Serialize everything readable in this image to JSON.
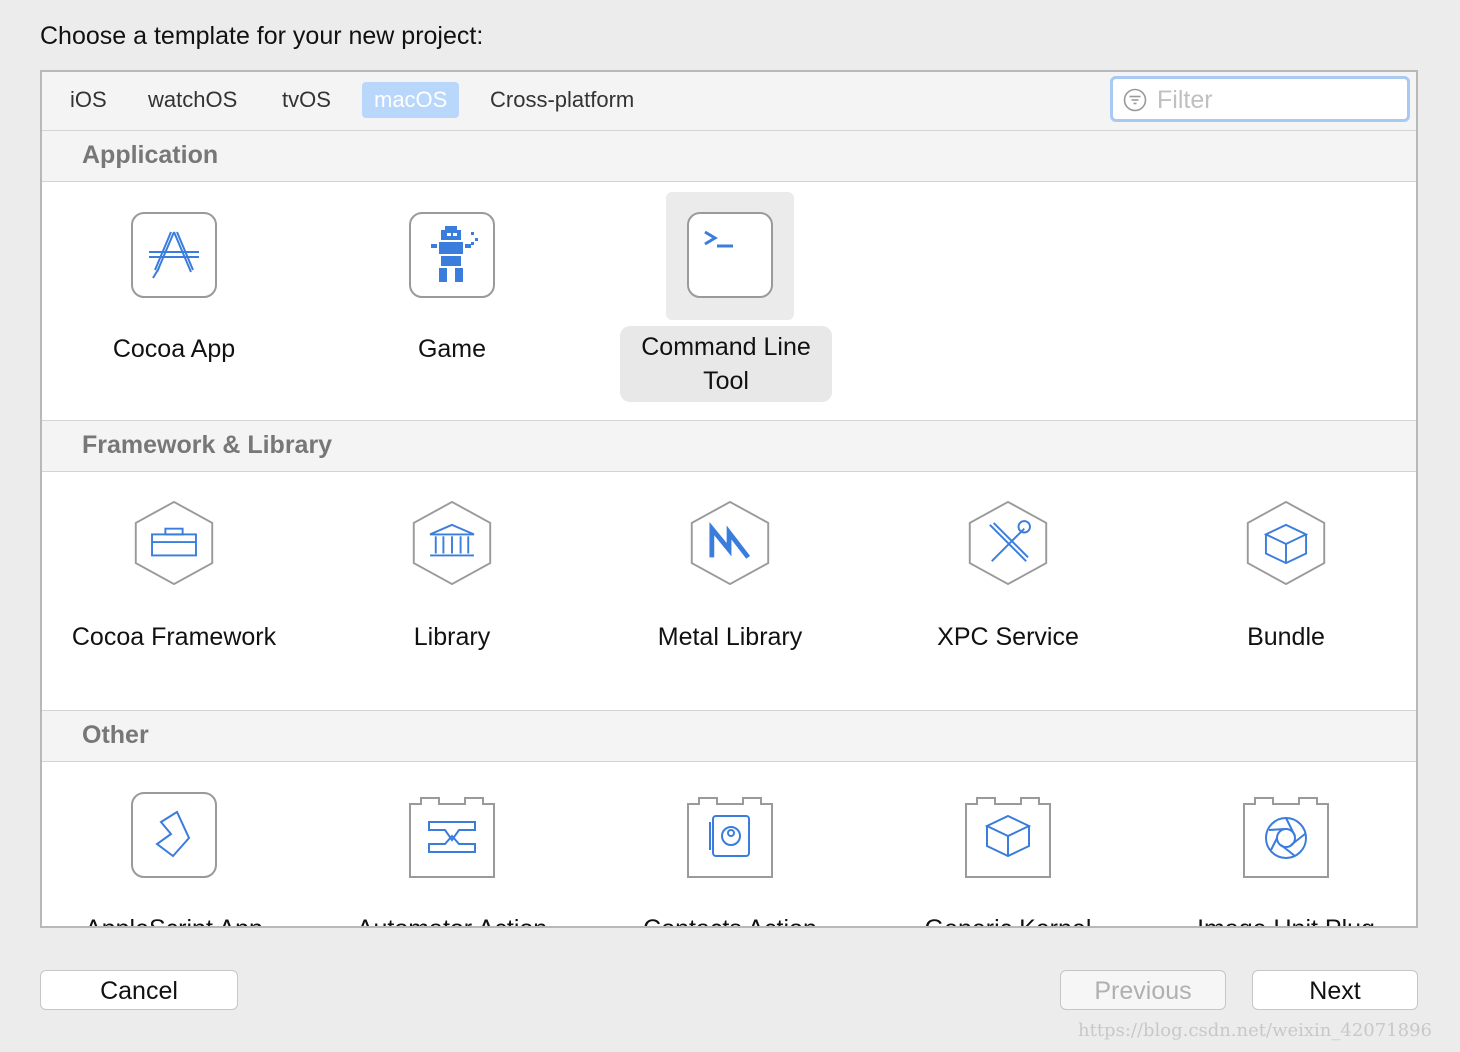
{
  "prompt": "Choose a template for your new project:",
  "tabs": [
    {
      "label": "iOS",
      "selected": false
    },
    {
      "label": "watchOS",
      "selected": false
    },
    {
      "label": "tvOS",
      "selected": false
    },
    {
      "label": "macOS",
      "selected": true
    },
    {
      "label": "Cross-platform",
      "selected": false
    }
  ],
  "filter": {
    "placeholder": "Filter"
  },
  "sections": {
    "application": {
      "title": "Application",
      "items": [
        {
          "label": "Cocoa App",
          "icon": "app-store-icon"
        },
        {
          "label": "Game",
          "icon": "game-icon"
        },
        {
          "label": "Command Line Tool",
          "icon": "terminal-icon",
          "selected": true
        }
      ]
    },
    "framework": {
      "title": "Framework & Library",
      "items": [
        {
          "label": "Cocoa Framework",
          "icon": "toolbox-icon"
        },
        {
          "label": "Library",
          "icon": "library-icon"
        },
        {
          "label": "Metal Library",
          "icon": "metal-icon"
        },
        {
          "label": "XPC Service",
          "icon": "tools-icon"
        },
        {
          "label": "Bundle",
          "icon": "cube-icon"
        }
      ]
    },
    "other": {
      "title": "Other",
      "items": [
        {
          "label": "AppleScript App",
          "icon": "script-icon"
        },
        {
          "label": "Automator Action",
          "icon": "automator-icon"
        },
        {
          "label": "Contacts Action",
          "icon": "contacts-icon"
        },
        {
          "label": "Generic Kernel",
          "icon": "kernel-icon"
        },
        {
          "label": "Image Unit Plug",
          "icon": "aperture-icon"
        }
      ]
    }
  },
  "buttons": {
    "cancel": "Cancel",
    "previous": "Previous",
    "next": "Next"
  },
  "watermark": "https://blog.csdn.net/weixin_42071896",
  "colors": {
    "accent": "#3b7ddd",
    "tab_selected": "#b8d7fb",
    "section_bg": "#f4f4f4"
  }
}
